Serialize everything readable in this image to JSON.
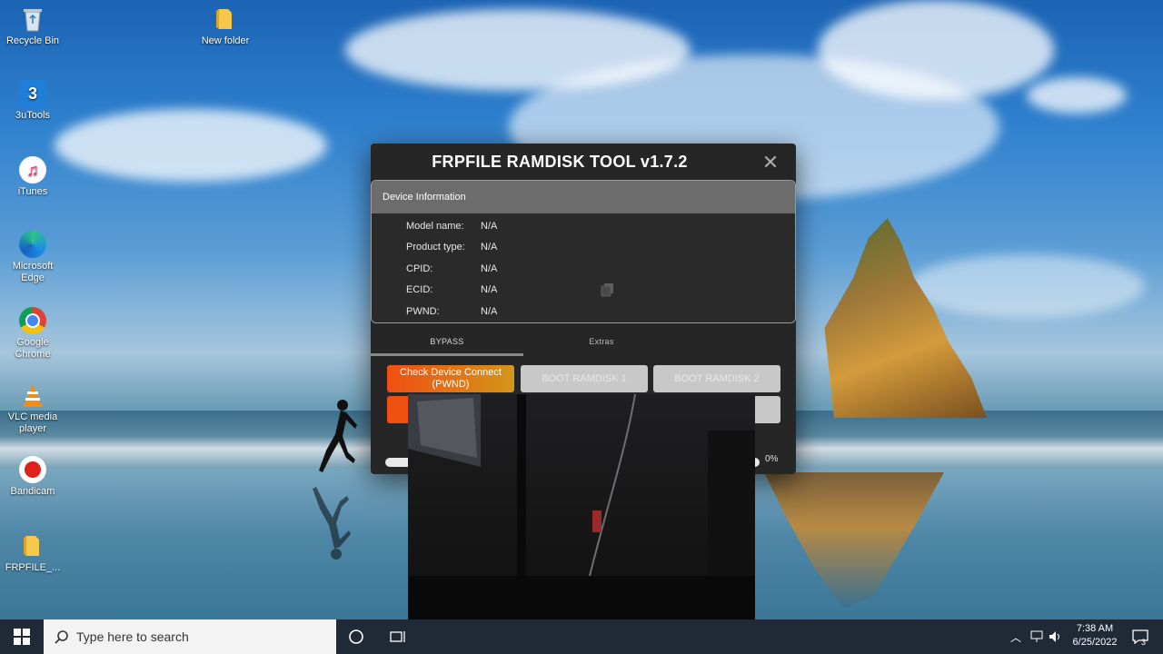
{
  "desktop": {
    "icons": [
      {
        "label": "Recycle Bin",
        "icon": "recycle-bin-icon"
      },
      {
        "label": "New folder",
        "icon": "folder-icon"
      },
      {
        "label": "3uTools",
        "icon": "3utools-icon"
      },
      {
        "label": "iTunes",
        "icon": "itunes-icon"
      },
      {
        "label": "Microsoft Edge",
        "icon": "edge-icon"
      },
      {
        "label": "Google Chrome",
        "icon": "chrome-icon"
      },
      {
        "label": "VLC media player",
        "icon": "vlc-icon"
      },
      {
        "label": "Bandicam",
        "icon": "bandicam-icon"
      },
      {
        "label": "FRPFILE_...",
        "icon": "folder-icon"
      }
    ]
  },
  "app": {
    "title": "FRPFILE RAMDISK TOOL v1.7.2",
    "close_symbol": "✕",
    "device_info": {
      "header": "Device Information",
      "rows": [
        {
          "key": "Model name:",
          "value": "N/A"
        },
        {
          "key": "Product type:",
          "value": "N/A"
        },
        {
          "key": "CPID:",
          "value": "N/A"
        },
        {
          "key": "ECID:",
          "value": "N/A"
        },
        {
          "key": "PWND:",
          "value": "N/A"
        }
      ]
    },
    "tabs": [
      {
        "label": "BYPASS",
        "active": true
      },
      {
        "label": "Extras",
        "active": false
      }
    ],
    "buttons": {
      "check_device_line1": "Check Device Connect",
      "check_device_line2": "(PWND)",
      "boot_ramdisk_1": "BOOT RAMDISK 1",
      "boot_ramdisk_2": "BOOT RAMDISK 2"
    },
    "progress": {
      "value": 0,
      "label": "0%"
    }
  },
  "taskbar": {
    "search_placeholder": "Type here to search",
    "time": "7:38 AM",
    "date": "6/25/2022",
    "notification_count": "3"
  },
  "colors": {
    "accent_orange": "#f04f12",
    "accent_gold": "#d3961a",
    "window_bg": "#262626"
  }
}
